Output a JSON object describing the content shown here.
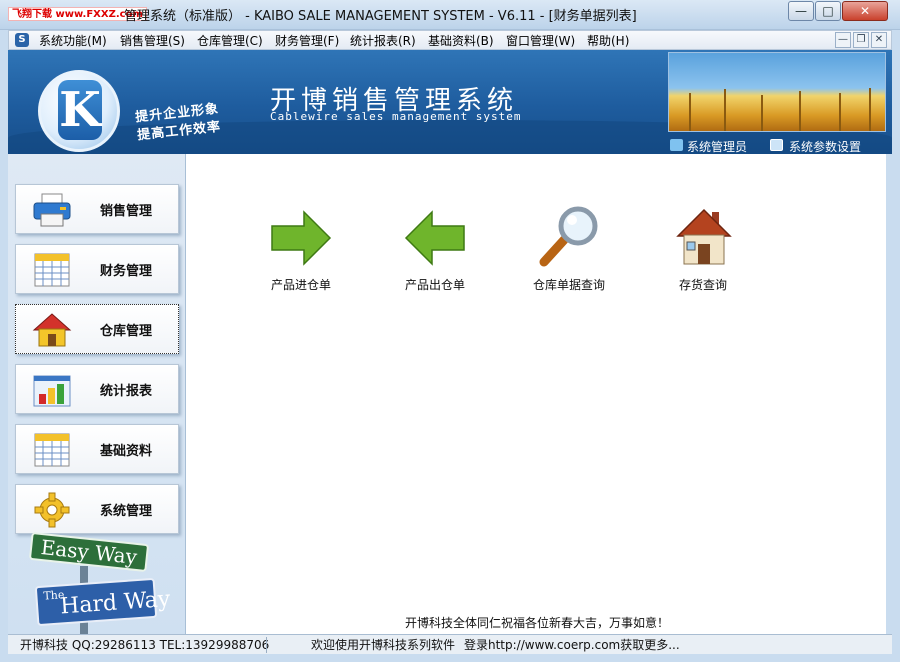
{
  "window": {
    "watermark": "飞翔下载 www.FXXZ.com",
    "title": "管理系统（标准版） - KAIBO SALE MANAGEMENT SYSTEM - V6.11 - [财务单据列表]",
    "min_glyph": "—",
    "max_glyph": "□",
    "close_glyph": "✕"
  },
  "menu": {
    "items": [
      "系统功能(M)",
      "销售管理(S)",
      "仓库管理(C)",
      "财务管理(F)",
      "统计报表(R)",
      "基础资料(B)",
      "窗口管理(W)",
      "帮助(H)"
    ],
    "mdi_min": "—",
    "mdi_restore": "❐",
    "mdi_close": "✕"
  },
  "banner": {
    "logo_letter": "K",
    "slogan_line1": "提升企业形象",
    "slogan_line2": "提高工作效率",
    "title": "开博销售管理系统",
    "subtitle": "Cablewire sales management system",
    "admin_link": "系统管理员",
    "settings_link": "系统参数设置"
  },
  "nav": {
    "items": [
      {
        "label": "销售管理",
        "icon": "printer-icon"
      },
      {
        "label": "财务管理",
        "icon": "calendar-grid-icon"
      },
      {
        "label": "仓库管理",
        "icon": "house-icon"
      },
      {
        "label": "统计报表",
        "icon": "bar-chart-icon"
      },
      {
        "label": "基础资料",
        "icon": "calendar-grid-icon"
      },
      {
        "label": "系统管理",
        "icon": "gear-icon"
      }
    ],
    "active_index": 2,
    "sign_easy": "Easy Way",
    "sign_hard_the": "The",
    "sign_hard": "Hard Way"
  },
  "main": {
    "features": [
      {
        "label": "产品进仓单",
        "icon": "arrow-right-icon"
      },
      {
        "label": "产品出仓单",
        "icon": "arrow-left-icon"
      },
      {
        "label": "仓库单据查询",
        "icon": "magnifier-icon"
      },
      {
        "label": "存货查询",
        "icon": "house-icon"
      }
    ],
    "greeting": "开博科技全体同仁祝福各位新春大吉，万事如意！"
  },
  "status": {
    "contact": "开博科技 QQ:29286113 TEL:13929988706",
    "welcome": "欢迎使用开博科技系列软件",
    "website": "登录http://www.coerp.com获取更多..."
  },
  "colors": {
    "banner_blue": "#1e5c9e",
    "arrow_green": "#6fb52c",
    "accent_orange": "#d9741b"
  }
}
